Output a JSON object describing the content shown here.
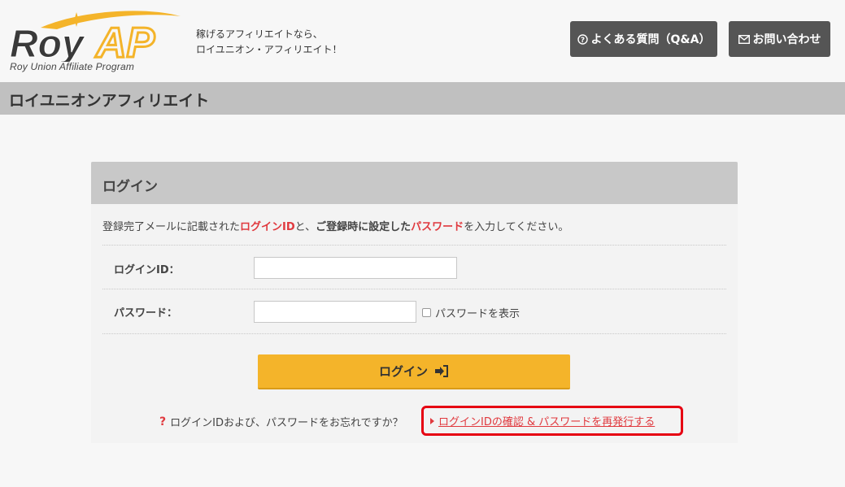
{
  "header": {
    "logo_text_1": "Roy",
    "logo_text_2": "AP",
    "logo_subtitle": "Roy Union Affiliate Program",
    "tagline_line1": "稼げるアフィリエイトなら、",
    "tagline_line2": "ロイユニオン・アフィリエイト！",
    "faq_label": "よくある質問（Q&A）",
    "contact_label": "お問い合わせ"
  },
  "band": {
    "title": "ロイユニオンアフィリエイト"
  },
  "login": {
    "title": "ログイン",
    "instruction": {
      "part1": "登録完了メールに記載された",
      "login_id": "ログインID",
      "part2": "と、",
      "part3": "ご登録時に設定した",
      "password": "パスワード",
      "part4": "を入力してください。"
    },
    "login_id_label": "ログインID：",
    "login_id_value": "",
    "password_label": "パスワード：",
    "password_value": "",
    "show_password_label": "パスワードを表示",
    "submit_label": "ログイン",
    "forgot_text": "ログインIDおよび、パスワードをお忘れですか？",
    "reissue_link": "ログインIDの確認 & パスワードを再発行する"
  },
  "colors": {
    "accent_red": "#e0393e",
    "button_yellow": "#f4b42a",
    "header_button": "#555555",
    "band_gray": "#c0c0c0",
    "highlight_red": "#e60012"
  }
}
